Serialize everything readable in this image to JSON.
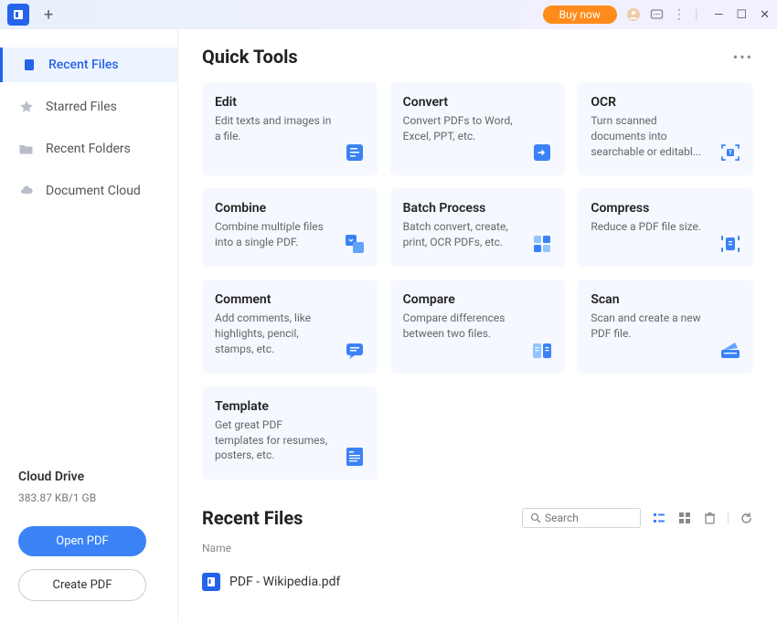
{
  "titlebar": {
    "buy_now": "Buy now"
  },
  "sidebar": {
    "items": [
      {
        "label": "Recent Files"
      },
      {
        "label": "Starred Files"
      },
      {
        "label": "Recent Folders"
      },
      {
        "label": "Document Cloud"
      }
    ],
    "cloud": {
      "title": "Cloud Drive",
      "usage": "383.87 KB/1 GB"
    },
    "open_pdf": "Open PDF",
    "create_pdf": "Create PDF"
  },
  "quick_tools": {
    "title": "Quick Tools",
    "cards": [
      {
        "title": "Edit",
        "desc": "Edit texts and images in a file."
      },
      {
        "title": "Convert",
        "desc": "Convert PDFs to Word, Excel, PPT, etc."
      },
      {
        "title": "OCR",
        "desc": "Turn scanned documents into searchable or editabl..."
      },
      {
        "title": "Combine",
        "desc": "Combine multiple files into a single PDF."
      },
      {
        "title": "Batch Process",
        "desc": "Batch convert, create, print, OCR PDFs, etc."
      },
      {
        "title": "Compress",
        "desc": "Reduce a PDF file size."
      },
      {
        "title": "Comment",
        "desc": "Add comments, like highlights, pencil, stamps, etc."
      },
      {
        "title": "Compare",
        "desc": "Compare differences between two files."
      },
      {
        "title": "Scan",
        "desc": "Scan and create a new PDF file."
      },
      {
        "title": "Template",
        "desc": "Get great PDF templates for resumes, posters, etc."
      }
    ]
  },
  "recent": {
    "title": "Recent Files",
    "search_placeholder": "Search",
    "column_name": "Name",
    "files": [
      {
        "name": "PDF - Wikipedia.pdf"
      }
    ]
  }
}
